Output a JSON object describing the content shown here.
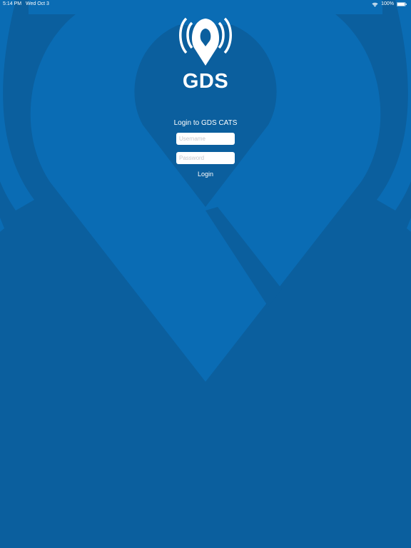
{
  "status_bar": {
    "time": "5:14 PM",
    "date": "Wed Oct 3",
    "battery": "100%",
    "icons": [
      "wifi-icon",
      "battery-icon"
    ]
  },
  "brand": {
    "logo_icon": "location-pin-signal-icon",
    "name": "GDS"
  },
  "login": {
    "title": "Login to GDS CATS",
    "username_placeholder": "Username",
    "password_placeholder": "Password",
    "button_label": "Login"
  },
  "colors": {
    "background": "#0b5f9e",
    "pin_light": "#0a6cb4",
    "text": "#ffffff"
  }
}
